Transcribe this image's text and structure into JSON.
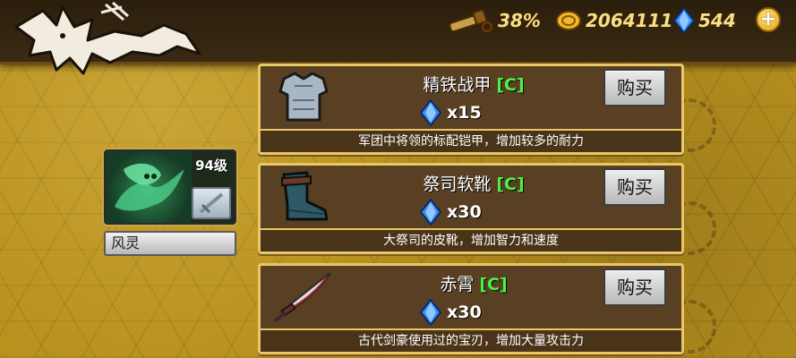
{
  "header": {
    "scope_value": "38%",
    "gold_value": "2064111",
    "gem_value": "544",
    "add_symbol": "+"
  },
  "hero": {
    "level": "94级",
    "name": "风灵"
  },
  "shop_items": [
    {
      "name": "精铁战甲",
      "grade": "[C]",
      "price": "x15",
      "buy_label": "购买",
      "description": "军团中将领的标配铠甲，增加较多的耐力"
    },
    {
      "name": "祭司软靴",
      "grade": "[C]",
      "price": "x30",
      "buy_label": "购买",
      "description": "大祭司的皮靴，增加智力和速度"
    },
    {
      "name": "赤霄",
      "grade": "[C]",
      "price": "x30",
      "buy_label": "购买",
      "description": "古代剑豪使用过的宝刃，增加大量攻击力"
    }
  ],
  "colors": {
    "grade_green": "#4bf04b",
    "panel_border": "#e9c766",
    "panel_bg": "#5a4023",
    "resource_text": "#f6e08a"
  },
  "icons": {
    "back": "bat-wing-back-icon",
    "scope": "spyglass-icon",
    "gold": "gold-coin-icon",
    "gem": "blue-gem-icon",
    "armor": "iron-armor-icon",
    "boots": "boots-icon",
    "sword": "sword-icon"
  }
}
